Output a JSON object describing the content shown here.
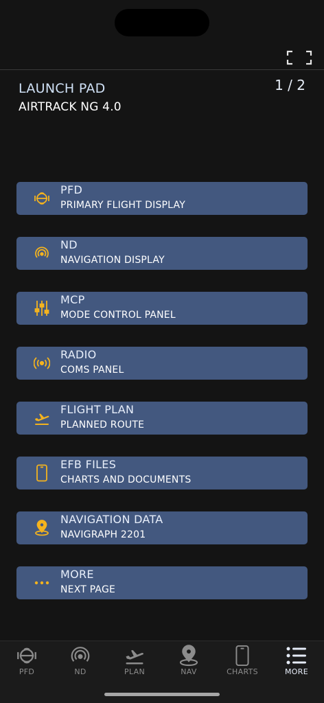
{
  "header": {
    "title": "LAUNCH PAD",
    "subtitle": "AIRTRACK NG 4.0",
    "page_indicator": "1 / 2"
  },
  "colors": {
    "background": "#141414",
    "card": "#43587f",
    "icon_accent": "#f4b31e",
    "tab_inactive": "#8c8c8c",
    "tab_active": "#e6ecf8"
  },
  "menu": {
    "items": [
      {
        "icon": "pfd-icon",
        "title": "PFD",
        "subtitle": "PRIMARY FLIGHT DISPLAY"
      },
      {
        "icon": "nd-icon",
        "title": "ND",
        "subtitle": "NAVIGATION DISPLAY"
      },
      {
        "icon": "sliders-icon",
        "title": "MCP",
        "subtitle": "MODE CONTROL PANEL"
      },
      {
        "icon": "radio-icon",
        "title": "RADIO",
        "subtitle": "COMS PANEL"
      },
      {
        "icon": "plane-takeoff-icon",
        "title": "FLIGHT PLAN",
        "subtitle": "PLANNED ROUTE"
      },
      {
        "icon": "tablet-icon",
        "title": "EFB FILES",
        "subtitle": "CHARTS AND DOCUMENTS"
      },
      {
        "icon": "location-pin-icon",
        "title": "NAVIGATION DATA",
        "subtitle": "NAVIGRAPH 2201"
      },
      {
        "icon": "ellipsis-icon",
        "title": "MORE",
        "subtitle": "NEXT PAGE"
      }
    ]
  },
  "tabbar": {
    "tabs": [
      {
        "icon": "pfd-icon",
        "label": "PFD",
        "active": false
      },
      {
        "icon": "nd-icon",
        "label": "ND",
        "active": false
      },
      {
        "icon": "plane-takeoff-icon",
        "label": "PLAN",
        "active": false
      },
      {
        "icon": "location-pin-icon",
        "label": "NAV",
        "active": false
      },
      {
        "icon": "tablet-icon",
        "label": "CHARTS",
        "active": false
      },
      {
        "icon": "list-icon",
        "label": "MORE",
        "active": true
      }
    ]
  }
}
